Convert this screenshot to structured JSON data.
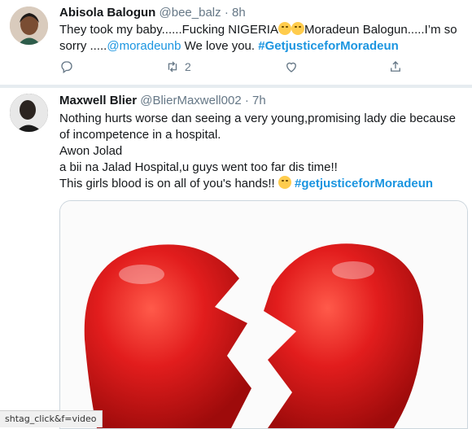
{
  "tweets": [
    {
      "name": "Abisola Balogun",
      "handle": "@bee_balz",
      "dot": "·",
      "time": "8h",
      "text_a": "They took my baby......Fucking NIGERIA",
      "text_b": "Moradeun Balogun.....I’m so sorry .....",
      "mention": "@moradeunb",
      "text_c": " We love you. ",
      "hashtag": "#Getjusticeformoradeun",
      "hashtag_display": "#GetjusticeforMoradeun",
      "retweet_count": "2",
      "icons": {
        "reply": "reply-icon",
        "retweet": "retweet-icon",
        "like": "like-icon",
        "share": "share-icon"
      },
      "emoji": [
        "weary-face-emoji",
        "tired-face-emoji"
      ]
    },
    {
      "name": "Maxwell Blier",
      "handle": "@BlierMaxwell002",
      "dot": "·",
      "time": "7h",
      "line1": "Nothing hurts worse dan seeing a very young,promising lady die because of incompetence in a hospital.",
      "line2": "Awon Jolad",
      "line3": "a bii na Jalad Hospital,u guys went too far dis time!!",
      "line4": "This girls blood is on all of you's hands!! ",
      "hashtag": "#getjusticeforMoradeun",
      "emoji": [
        "persevering-face-emoji"
      ],
      "media": "broken-heart-image",
      "colors": {
        "heart": "#e21d1d"
      }
    }
  ],
  "statusbar": {
    "url": "shtag_click&f=video"
  },
  "colors": {
    "link": "#1b95e0",
    "muted": "#657786"
  }
}
